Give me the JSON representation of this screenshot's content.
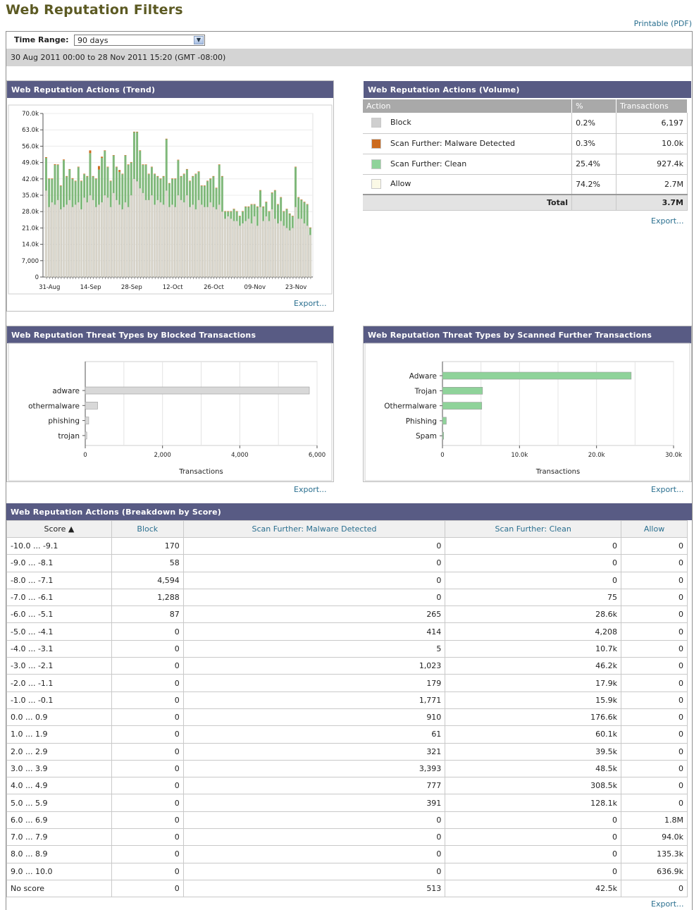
{
  "page": {
    "title": "Web Reputation Filters",
    "printable": "Printable (PDF)"
  },
  "time_range": {
    "label": "Time Range:",
    "value": "90 days",
    "range_text": "30 Aug 2011 00:00 to 28 Nov 2011 15:20 (GMT -08:00)"
  },
  "trend": {
    "title": "Web Reputation Actions (Trend)",
    "export": "Export..."
  },
  "volume": {
    "title": "Web Reputation Actions (Volume)",
    "headers": [
      "Action",
      "%",
      "Transactions"
    ],
    "rows": [
      {
        "action": "Block",
        "pct": "0.2%",
        "tx": "6,197",
        "color": "#cfcfcf"
      },
      {
        "action": "Scan Further: Malware Detected",
        "pct": "0.3%",
        "tx": "10.0k",
        "color": "#cc6a1e"
      },
      {
        "action": "Scan Further: Clean",
        "pct": "25.4%",
        "tx": "927.4k",
        "color": "#8fd39a"
      },
      {
        "action": "Allow",
        "pct": "74.2%",
        "tx": "2.7M",
        "color": "#fbf9e6"
      }
    ],
    "total_label": "Total",
    "total": "3.7M",
    "export": "Export..."
  },
  "blocked": {
    "title": "Web Reputation Threat Types by Blocked Transactions",
    "export": "Export..."
  },
  "scanned": {
    "title": "Web Reputation Threat Types by Scanned Further Transactions",
    "export": "Export..."
  },
  "breakdown": {
    "title": "Web Reputation Actions (Breakdown by Score)",
    "headers": {
      "score": "Score ▲",
      "block": "Block",
      "malware": "Scan Further: Malware Detected",
      "clean": "Scan Further: Clean",
      "allow": "Allow"
    },
    "rows": [
      [
        "-10.0 ... -9.1",
        "170",
        "0",
        "0",
        "0"
      ],
      [
        "-9.0 ... -8.1",
        "58",
        "0",
        "0",
        "0"
      ],
      [
        "-8.0 ... -7.1",
        "4,594",
        "0",
        "0",
        "0"
      ],
      [
        "-7.0 ... -6.1",
        "1,288",
        "0",
        "75",
        "0"
      ],
      [
        "-6.0 ... -5.1",
        "87",
        "265",
        "28.6k",
        "0"
      ],
      [
        "-5.0 ... -4.1",
        "0",
        "414",
        "4,208",
        "0"
      ],
      [
        "-4.0 ... -3.1",
        "0",
        "5",
        "10.7k",
        "0"
      ],
      [
        "-3.0 ... -2.1",
        "0",
        "1,023",
        "46.2k",
        "0"
      ],
      [
        "-2.0 ... -1.1",
        "0",
        "179",
        "17.9k",
        "0"
      ],
      [
        "-1.0 ... -0.1",
        "0",
        "1,771",
        "15.9k",
        "0"
      ],
      [
        "0.0 ... 0.9",
        "0",
        "910",
        "176.6k",
        "0"
      ],
      [
        "1.0 ... 1.9",
        "0",
        "61",
        "60.1k",
        "0"
      ],
      [
        "2.0 ... 2.9",
        "0",
        "321",
        "39.5k",
        "0"
      ],
      [
        "3.0 ... 3.9",
        "0",
        "3,393",
        "48.5k",
        "0"
      ],
      [
        "4.0 ... 4.9",
        "0",
        "777",
        "308.5k",
        "0"
      ],
      [
        "5.0 ... 5.9",
        "0",
        "391",
        "128.1k",
        "0"
      ],
      [
        "6.0 ... 6.9",
        "0",
        "0",
        "0",
        "1.8M"
      ],
      [
        "7.0 ... 7.9",
        "0",
        "0",
        "0",
        "94.0k"
      ],
      [
        "8.0 ... 8.9",
        "0",
        "0",
        "0",
        "135.3k"
      ],
      [
        "9.0 ... 10.0",
        "0",
        "0",
        "0",
        "636.9k"
      ],
      [
        "No score",
        "0",
        "513",
        "42.5k",
        "0"
      ]
    ],
    "export": "Export..."
  },
  "chart_data": [
    {
      "type": "bar",
      "stacked": true,
      "title": "Web Reputation Actions (Trend)",
      "ylim": [
        0,
        70000
      ],
      "yticks": [
        "0",
        "7,000",
        "14.0k",
        "21.0k",
        "28.0k",
        "35.0k",
        "42.0k",
        "49.0k",
        "56.0k",
        "63.0k",
        "70.0k"
      ],
      "xticks": [
        "31-Aug",
        "14-Sep",
        "28-Sep",
        "12-Oct",
        "26-Oct",
        "09-Nov",
        "23-Nov"
      ],
      "series": [
        {
          "name": "Allow",
          "color": "#dedad0",
          "values": [
            37000,
            30000,
            32000,
            31000,
            33000,
            29000,
            30000,
            31000,
            33000,
            30000,
            31000,
            32000,
            29000,
            34000,
            32000,
            35000,
            33000,
            30000,
            31000,
            32000,
            35000,
            34000,
            30000,
            36000,
            33000,
            31000,
            29000,
            32000,
            30000,
            35000,
            42000,
            41000,
            38000,
            36000,
            33000,
            33000,
            35000,
            31000,
            33000,
            32000,
            31000,
            37000,
            30000,
            31000,
            30000,
            35000,
            33000,
            32000,
            35000,
            30000,
            31000,
            29000,
            33000,
            31000,
            30000,
            30000,
            32000,
            30000,
            29000,
            31000,
            28000,
            25000,
            26000,
            25000,
            24000,
            24000,
            22000,
            23000,
            24000,
            25000,
            23000,
            26000,
            22000,
            30000,
            24000,
            26000,
            24000,
            29000,
            25000,
            23000,
            24000,
            22000,
            21000,
            20000,
            21000,
            30000,
            25000,
            25000,
            23000,
            22000,
            18000
          ]
        },
        {
          "name": "Scan Further: Clean",
          "color": "#7fb87a",
          "values": [
            14000,
            12000,
            10000,
            17000,
            15000,
            10000,
            20000,
            12000,
            13000,
            12000,
            10000,
            15000,
            12000,
            10000,
            11000,
            18000,
            10000,
            12000,
            15000,
            19000,
            19000,
            13000,
            11000,
            16000,
            14000,
            14000,
            15000,
            20000,
            18000,
            14000,
            20000,
            21000,
            16000,
            12000,
            15000,
            11000,
            12000,
            13000,
            10000,
            10000,
            12000,
            22000,
            10000,
            11000,
            12000,
            15000,
            10000,
            12000,
            11000,
            11000,
            12000,
            15000,
            12000,
            8000,
            9000,
            11000,
            10000,
            13000,
            9000,
            17000,
            15000,
            3000,
            2000,
            3000,
            5000,
            4000,
            4000,
            5000,
            6000,
            5000,
            8000,
            5000,
            8000,
            7000,
            6000,
            6000,
            4000,
            7000,
            12000,
            8000,
            10000,
            6000,
            8000,
            7000,
            5000,
            17000,
            9000,
            8000,
            9000,
            9000,
            3000
          ]
        },
        {
          "name": "Scan Further: Malware Detected",
          "color": "#cc6a1e",
          "values": [
            300,
            200,
            200,
            300,
            200,
            200,
            300,
            200,
            200,
            300,
            200,
            200,
            200,
            200,
            200,
            1200,
            200,
            200,
            1500,
            500,
            200,
            200,
            200,
            200,
            200,
            800,
            200,
            200,
            200,
            200,
            200,
            200,
            200,
            200,
            200,
            200,
            200,
            200,
            200,
            200,
            200,
            200,
            200,
            200,
            200,
            200,
            200,
            200,
            200,
            200,
            200,
            200,
            200,
            200,
            200,
            200,
            200,
            200,
            200,
            200,
            200,
            200,
            200,
            200,
            200,
            200,
            200,
            200,
            200,
            200,
            200,
            200,
            200,
            200,
            200,
            200,
            200,
            200,
            200,
            200,
            200,
            200,
            200,
            200,
            200,
            200,
            200,
            200,
            200,
            200,
            200
          ]
        }
      ]
    },
    {
      "type": "bar",
      "orientation": "horizontal",
      "title": "Web Reputation Threat Types by Blocked Transactions",
      "categories": [
        "adware",
        "othermalware",
        "phishing",
        "trojan"
      ],
      "values": [
        5800,
        320,
        90,
        40
      ],
      "color": "#d8d8d8",
      "xlabel": "Transactions",
      "xlim": [
        0,
        6000
      ],
      "xticks": [
        "0",
        "2,000",
        "4,000",
        "6,000"
      ]
    },
    {
      "type": "bar",
      "orientation": "horizontal",
      "title": "Web Reputation Threat Types by Scanned Further Transactions",
      "categories": [
        "Adware",
        "Trojan",
        "Othermalware",
        "Phishing",
        "Spam"
      ],
      "values": [
        24500,
        5200,
        5100,
        500,
        150
      ],
      "color": "#8fd39a",
      "xlabel": "Transactions",
      "xlim": [
        0,
        30000
      ],
      "xticks": [
        "0",
        "10.0k",
        "20.0k",
        "30.0k"
      ]
    }
  ]
}
